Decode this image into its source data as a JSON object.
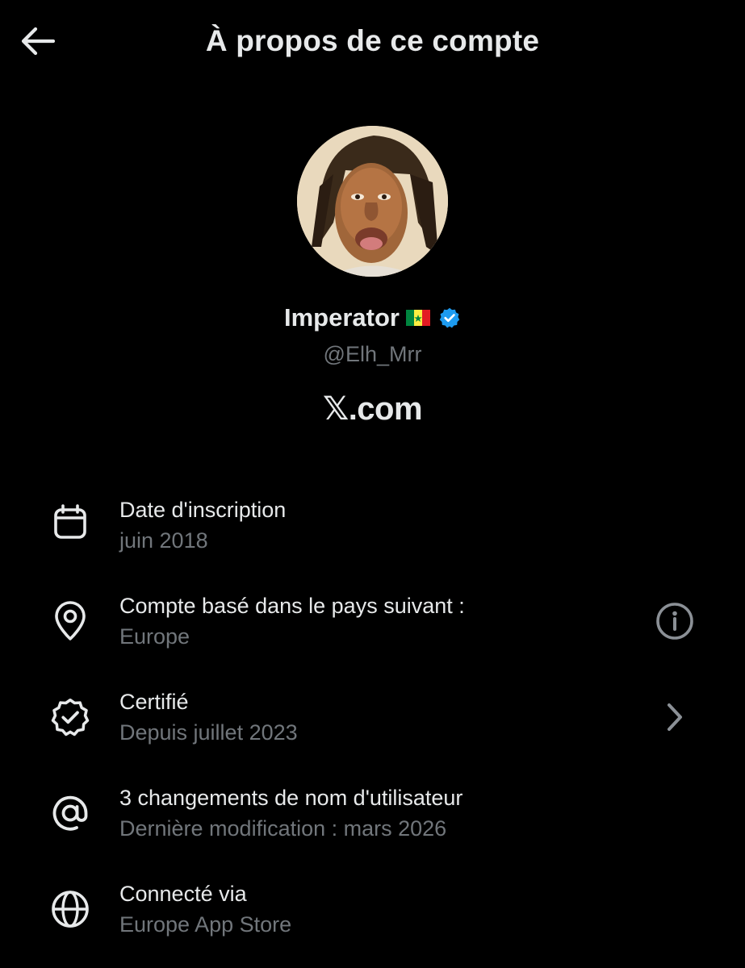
{
  "header": {
    "title": "À propos de ce compte",
    "back_icon": "arrow-left-icon"
  },
  "profile": {
    "display_name": "Imperator",
    "flag_icon": "senegal-flag-icon",
    "verified_icon": "verified-badge-icon",
    "verified_color": "#1d9bf0",
    "handle": "@Elh_Mrr",
    "avatar_icon": "profile-avatar"
  },
  "brand": {
    "mark": "𝕏",
    "text": ".com"
  },
  "info": [
    {
      "icon": "calendar-icon",
      "title": "Date d'inscription",
      "subtitle": "juin 2018"
    },
    {
      "icon": "location-pin-icon",
      "title": "Compte basé dans le pays suivant :",
      "subtitle": "Europe",
      "trailing_icon": "info-icon"
    },
    {
      "icon": "verified-check-icon",
      "title": "Certifié",
      "subtitle": "Depuis juillet 2023",
      "trailing_icon": "chevron-right-icon"
    },
    {
      "icon": "at-sign-icon",
      "title": "3 changements de nom d'utilisateur",
      "subtitle": "Dernière modification : mars 2026"
    },
    {
      "icon": "globe-icon",
      "title": "Connecté via",
      "subtitle": "Europe App Store"
    }
  ],
  "colors": {
    "background": "#000000",
    "primary_text": "#e7e9ea",
    "secondary_text": "#71767b"
  }
}
